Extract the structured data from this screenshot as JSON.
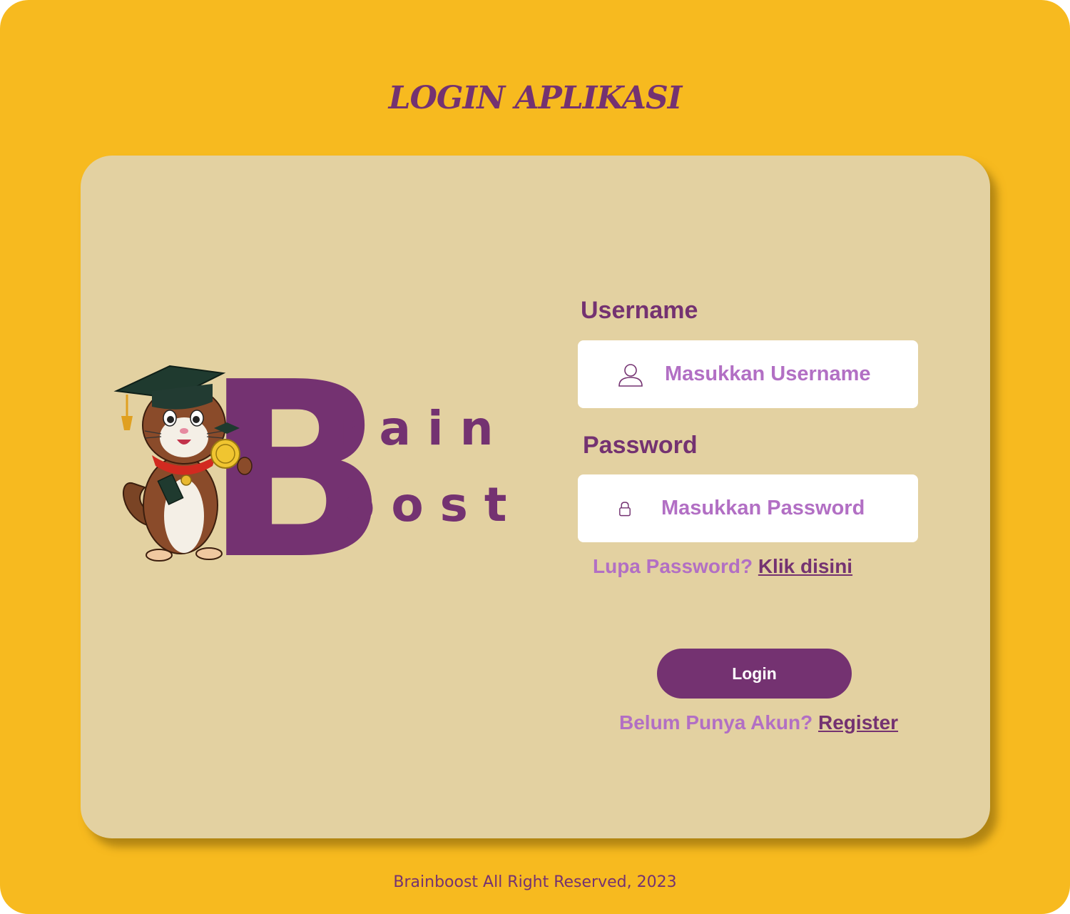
{
  "page": {
    "title": "LOGIN APLIKASI",
    "footer": "Brainboost All Right Reserved, 2023"
  },
  "logo": {
    "big_letter": "B",
    "line1": "r a i n",
    "line2": "o o s t",
    "mascot_icon": "graduate-chipmunk-mascot"
  },
  "form": {
    "username_label": "Username",
    "username_placeholder": "Masukkan Username",
    "username_icon": "user-icon",
    "password_label": "Password",
    "password_placeholder": "Masukkan Password",
    "password_icon": "lock-icon",
    "forgot_text": "Lupa Password?",
    "forgot_link": "Klik disini",
    "login_button": "Login",
    "register_text": "Belum Punya Akun?",
    "register_link": "Register"
  },
  "colors": {
    "background": "#F7BA1F",
    "card": "#E3D1A1",
    "primary": "#743271",
    "accent_text": "#B26FC4",
    "input_bg": "#FFFFFF"
  }
}
